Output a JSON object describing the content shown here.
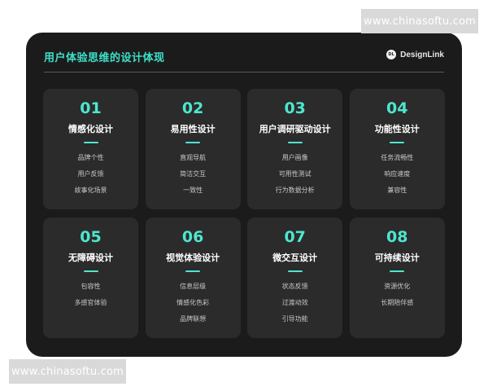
{
  "watermark": {
    "text": "www.chinasoftu.com"
  },
  "header": {
    "title": "用户体验思维的设计体现",
    "brand_logo_text": "DL",
    "brand_name": "DesignLink"
  },
  "cards": [
    {
      "number": "01",
      "title": "情感化设计",
      "items": [
        "品牌个性",
        "用户反馈",
        "故事化场景"
      ]
    },
    {
      "number": "02",
      "title": "易用性设计",
      "items": [
        "直观导航",
        "简洁交互",
        "一致性"
      ]
    },
    {
      "number": "03",
      "title": "用户调研驱动设计",
      "items": [
        "用户画像",
        "可用性测试",
        "行为数据分析"
      ]
    },
    {
      "number": "04",
      "title": "功能性设计",
      "items": [
        "任务流畅性",
        "响应速度",
        "兼容性"
      ]
    },
    {
      "number": "05",
      "title": "无障碍设计",
      "items": [
        "包容性",
        "多感官体验"
      ]
    },
    {
      "number": "06",
      "title": "视觉体验设计",
      "items": [
        "信息层级",
        "情感化色彩",
        "品牌联想"
      ]
    },
    {
      "number": "07",
      "title": "微交互设计",
      "items": [
        "状态反馈",
        "过渡动效",
        "引导功能"
      ]
    },
    {
      "number": "08",
      "title": "可持续设计",
      "items": [
        "资源优化",
        "长期陪伴感"
      ]
    }
  ],
  "colors": {
    "accent": "#4ee6cf",
    "panel_bg": "#1b1b1b",
    "card_bg": "#2b2b2b"
  }
}
